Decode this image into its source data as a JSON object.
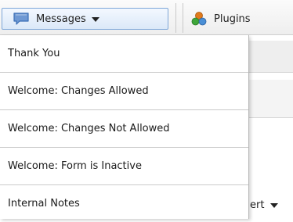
{
  "toolbar": {
    "messages_button": {
      "label": "Messages",
      "icon": "chat-bubble-icon"
    },
    "plugins_button": {
      "label": "Plugins",
      "icon": "puzzle-piece-icon"
    }
  },
  "menu": {
    "items": [
      {
        "label": "Thank You"
      },
      {
        "label": "Welcome: Changes Allowed"
      },
      {
        "label": "Welcome: Changes Not Allowed"
      },
      {
        "label": "Welcome: Form is Inactive"
      },
      {
        "label": "Internal Notes"
      }
    ]
  },
  "background": {
    "insert_label_fragment": "ert"
  },
  "colors": {
    "button_border": "#7ea6d8",
    "menu_divider": "#c9c9c9",
    "icon_blue": "#3b6fb6",
    "plugin_green": "#3fa63a",
    "plugin_orange": "#e07a1b"
  }
}
